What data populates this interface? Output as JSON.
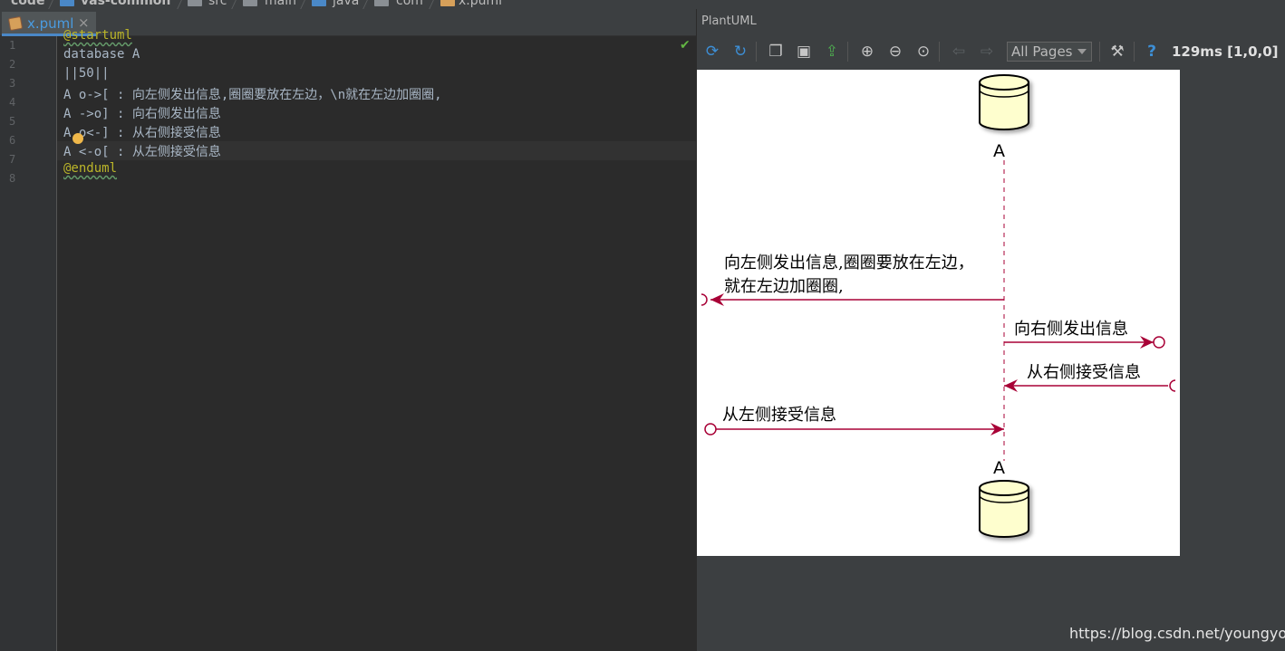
{
  "breadcrumb": [
    "code",
    "vas-common",
    "src",
    "main",
    "java",
    "com",
    "x.puml"
  ],
  "editor": {
    "tab_label": "x.puml",
    "tab_close": "×",
    "line_numbers": [
      "1",
      "2",
      "3",
      "4",
      "5",
      "6",
      "7",
      "8"
    ],
    "lines": [
      "@startuml",
      "database A",
      "||50||",
      "A o->[ : 向左侧发出信息,圈圈要放在左边，\\n就在左边加圈圈,",
      "A ->o] : 向右侧发出信息",
      "A o<-] : 从右侧接受信息",
      "A <-o[ : 从左侧接受信息",
      "@enduml"
    ],
    "active_line": 7
  },
  "plantuml": {
    "panel_title": "PlantUML",
    "toolbar": {
      "icons": [
        "refresh-icon",
        "sync-icon",
        "copy-icon",
        "save-icon",
        "export-icon",
        "zoom-in-icon",
        "zoom-out-icon",
        "actual-size-icon",
        "previous-page-icon",
        "next-page-icon",
        "settings-icon",
        "help-icon"
      ],
      "pages_select": "All Pages",
      "help": "?",
      "timing": "129ms [1,0,0]"
    },
    "diagram": {
      "participant": "A",
      "messages": [
        {
          "direction": "outgoing-left",
          "text_line1": "向左侧发出信息,圈圈要放在左边，",
          "text_line2": "就在左边加圈圈,"
        },
        {
          "direction": "outgoing-right",
          "text_line1": "向右侧发出信息"
        },
        {
          "direction": "incoming-right",
          "text_line1": "从右侧接受信息"
        },
        {
          "direction": "incoming-left",
          "text_line1": "从左侧接受信息"
        }
      ],
      "colors": {
        "arrow": "#a80036",
        "database_fill": "#fefece",
        "lifeline": "#a80036"
      }
    }
  },
  "watermark": "https://blog.csdn.net/youngyouth"
}
